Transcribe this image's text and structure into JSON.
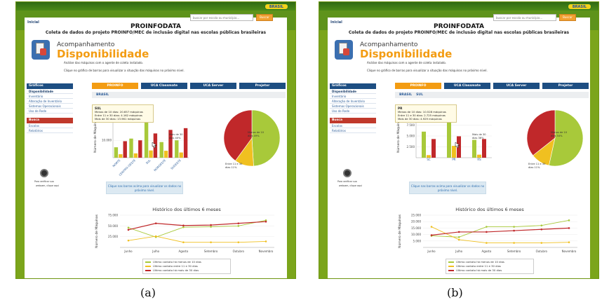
{
  "captions": [
    "(a)",
    "(b)"
  ],
  "shots": [
    {
      "id": "a",
      "flag": "BRASIL",
      "site_link": "Inicial",
      "search_placeholder": "buscar por escola ou município...",
      "search_button": "Buscar",
      "title": "PROINFODATA",
      "subtitle": "Coleta de dados do projeto PROINFO/MEC de inclusão digital nas escolas públicas brasileiras",
      "heading_small": "Acompanhamento",
      "heading_big": "Disponibilidade",
      "desc1": "Análise das máquinas com o agente de coleta instalado.",
      "desc2": "Clique no gráfico de barras para visualizar a situação das máquinas no próximo nível.",
      "nav_head1": "Gráficos",
      "nav_items1": [
        "Disponibilidade",
        "Inventário",
        "Alteração de Inventário",
        "Sistemas Operacionais",
        "Uso de Rede"
      ],
      "nav_head2": "Busca",
      "nav_items2": [
        "Escolas",
        "Relatórios"
      ],
      "cam_text1": "Para verificar sua",
      "cam_text2": "webcam, clique aqui",
      "tabs": [
        "PROINFO",
        "UCA Classmate",
        "UCA Server",
        "Projetor"
      ],
      "crumbs": [
        "BRASIL"
      ],
      "tooltip_title": "SUL",
      "tooltip_lines": [
        "Menos de 10 dias: 20.657 máquinas",
        "Entre 11 e 30 dias: 4.162 máquinas",
        "Mais de 30 dias: 13.961 máquinas"
      ],
      "bar_ylabel": "Número de Máquinas",
      "pie_labels": {
        "more30": "Mais de 30 dias 40%",
        "less10": "Menos de 10 dias 49%",
        "mid": "Entre 11 e 30 dias 11%"
      },
      "hint": "Clique nas barras acima para visualizar os dados no próximo nível.",
      "history_title": "Histórico dos últimos 6 meses",
      "line_ylabel": "Número de Máquinas",
      "legend": [
        "Último contato há menos de 10 dias",
        "Último contato entre 11 e 30 dias",
        "Último contato há mais de 30 dias"
      ],
      "colors": {
        "green": "#a8c93a",
        "yellow": "#f0c020",
        "red": "#c0282a"
      },
      "chart_data": [
        {
          "type": "bar",
          "categories": [
            "NORTE",
            "CENTRO-OESTE",
            "SUL",
            "NORDESTE",
            "SUDESTE"
          ],
          "yticks": [
            "10.000"
          ],
          "ylabel": "Número de Máquinas",
          "ylim": [
            0,
            25000
          ],
          "series": [
            {
              "name": "Menos de 10 dias",
              "values": [
                6000,
                11000,
                20657,
                9000,
                10000
              ]
            },
            {
              "name": "Entre 11 e 30 dias",
              "values": [
                2000,
                2500,
                4162,
                4000,
                3000
              ]
            },
            {
              "name": "Mais de 30 dias",
              "values": [
                9500,
                10000,
                13961,
                16000,
                17000
              ]
            }
          ]
        },
        {
          "type": "pie",
          "slices": [
            {
              "label": "Menos de 10 dias",
              "value": 49
            },
            {
              "label": "Entre 11 e 30 dias",
              "value": 11
            },
            {
              "label": "Mais de 30 dias",
              "value": 40
            }
          ]
        },
        {
          "type": "line",
          "title": "Histórico dos últimos 6 meses",
          "categories": [
            "Junho",
            "Julho",
            "Agosto",
            "Setembro",
            "Outubro",
            "Novembro"
          ],
          "yticks": [
            "75.000",
            "50.000",
            "25.000"
          ],
          "ylabel": "Número de Máquinas",
          "ylim": [
            0,
            75000
          ],
          "series": [
            {
              "name": "Último contato há menos de 10 dias",
              "values": [
                46000,
                24000,
                47000,
                48000,
                50000,
                63000
              ]
            },
            {
              "name": "Último contato entre 11 e 30 dias",
              "values": [
                16000,
                26000,
                12000,
                12000,
                12000,
                14000
              ]
            },
            {
              "name": "Último contato há mais de 30 dias",
              "values": [
                41000,
                56000,
                51000,
                52000,
                56000,
                60000
              ]
            }
          ]
        }
      ]
    },
    {
      "id": "b",
      "flag": "BRASIL",
      "site_link": "Inicial",
      "search_placeholder": "buscar por escola ou município...",
      "search_button": "Buscar",
      "title": "PROINFODATA",
      "subtitle": "Coleta de dados do projeto PROINFO/MEC de inclusão digital nas escolas públicas brasileiras",
      "heading_small": "Acompanhamento",
      "heading_big": "Disponibilidade",
      "desc1": "Análise das máquinas com o agente de coleta instalado.",
      "desc2": "Clique no gráfico de barras para visualizar a situação das máquinas no próximo nível.",
      "nav_head1": "Gráficos",
      "nav_items1": [
        "Disponibilidade",
        "Inventário",
        "Alteração de Inventário",
        "Sistemas Operacionais",
        "Uso de Rede"
      ],
      "nav_head2": "Busca",
      "nav_items2": [
        "Escolas",
        "Relatórios"
      ],
      "cam_text1": "Para verificar sua",
      "cam_text2": "webcam, clique aqui",
      "tabs": [
        "PROINFO",
        "UCA Classmate",
        "UCA Server",
        "Projetor"
      ],
      "crumbs": [
        "BRASIL",
        "SUL"
      ],
      "tooltip_title": "PR",
      "tooltip_lines": [
        "Menos de 10 dias: 10.528 máquinas",
        "Entre 11 e 30 dias: 2.725 máquinas",
        "Mais de 30 dias: 4.929 máquinas"
      ],
      "bar_ylabel": "Número de Máquinas",
      "pie_labels": {
        "more30": "Mais de 30 dias 36%",
        "less10": "Menos de 10 dias 54%",
        "mid": "Entre 11 e 30 dias 11%"
      },
      "hint": "Clique nas barras acima para visualizar os dados no próximo nível.",
      "history_title": "Histórico dos últimos 6 meses",
      "line_ylabel": "Número de Máquinas",
      "legend": [
        "Último contato há menos de 10 dias",
        "Último contato entre 11 e 30 dias",
        "Último contato há mais de 30 dias"
      ],
      "colors": {
        "green": "#a8c93a",
        "yellow": "#f0c020",
        "red": "#c0282a"
      },
      "chart_data": [
        {
          "type": "bar",
          "categories": [
            "SC",
            "PR",
            "RS"
          ],
          "yticks": [
            "7.500",
            "5.000",
            "2.500"
          ],
          "ylabel": "Número de Máquinas",
          "ylim": [
            0,
            10000
          ],
          "series": [
            {
              "name": "Menos de 10 dias",
              "values": [
                6000,
                10528,
                4100
              ]
            },
            {
              "name": "Entre 11 e 30 dias",
              "values": [
                600,
                2725,
                700
              ]
            },
            {
              "name": "Mais de 30 dias",
              "values": [
                4300,
                4929,
                4300
              ]
            }
          ]
        },
        {
          "type": "pie",
          "slices": [
            {
              "label": "Menos de 10 dias",
              "value": 54
            },
            {
              "label": "Entre 11 e 30 dias",
              "value": 11
            },
            {
              "label": "Mais de 30 dias",
              "value": 36
            }
          ]
        },
        {
          "type": "line",
          "title": "Histórico dos últimos 6 meses",
          "categories": [
            "Junho",
            "Julho",
            "Agosto",
            "Setembro",
            "Outubro",
            "Novembro"
          ],
          "yticks": [
            "25.000",
            "20.000",
            "15.000",
            "10.000",
            "5.000"
          ],
          "ylabel": "Número de Máquinas",
          "ylim": [
            0,
            25000
          ],
          "series": [
            {
              "name": "Último contato há menos de 10 dias",
              "values": [
                9000,
                8000,
                16000,
                16000,
                17000,
                21000
              ]
            },
            {
              "name": "Último contato entre 11 e 30 dias",
              "values": [
                16000,
                6000,
                3500,
                3500,
                3500,
                4000
              ]
            },
            {
              "name": "Último contato há mais de 30 dias",
              "values": [
                9500,
                12000,
                12000,
                13000,
                14000,
                15000
              ]
            }
          ]
        }
      ]
    }
  ]
}
